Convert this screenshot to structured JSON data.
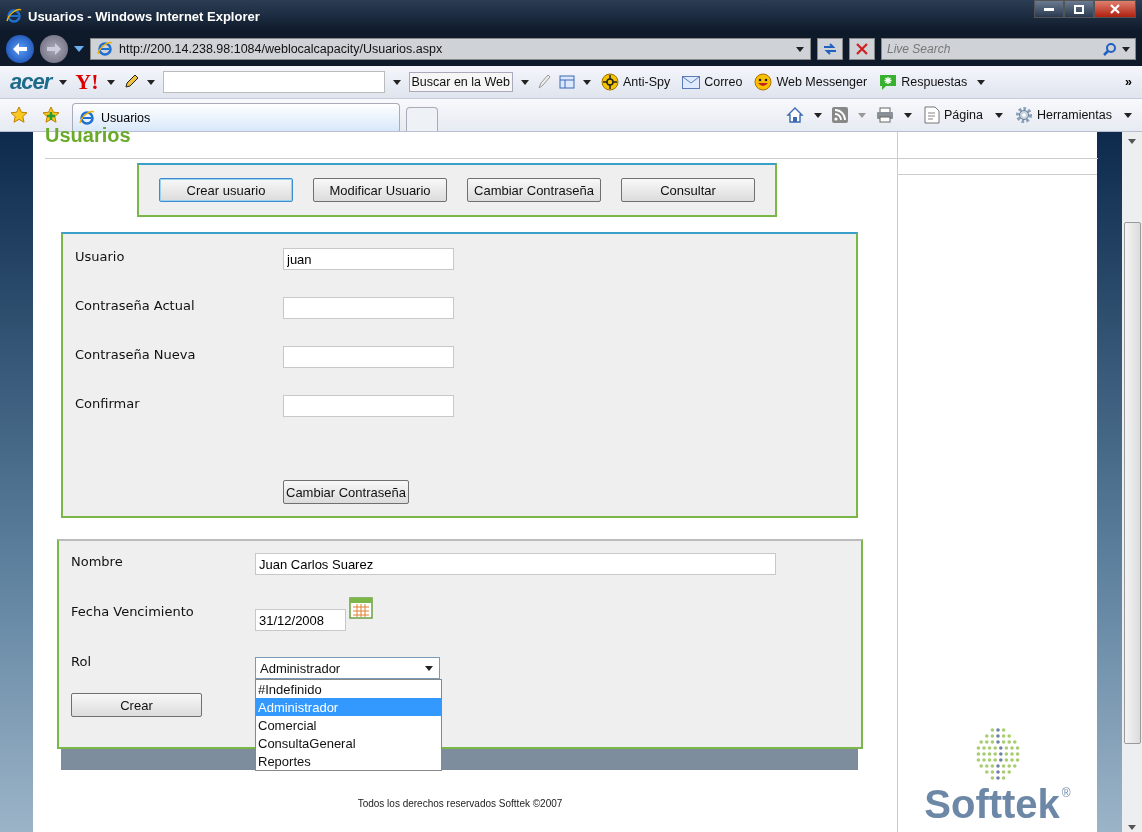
{
  "window": {
    "title": "Usuarios - Windows Internet Explorer"
  },
  "address_bar": {
    "url": "http://200.14.238.98:1084/weblocalcapacity/Usuarios.aspx"
  },
  "search": {
    "placeholder": "Live Search"
  },
  "toolbar": {
    "logos": [
      "acer",
      "Y!"
    ],
    "overflow": "»",
    "search_button": "Buscar en la Web",
    "items": [
      {
        "kind": "antispy",
        "label": "Anti-Spy"
      },
      {
        "kind": "mail",
        "label": "Correo"
      },
      {
        "kind": "messenger",
        "label": "Web Messenger"
      },
      {
        "kind": "answers",
        "label": "Respuestas"
      }
    ]
  },
  "tabs": [
    {
      "label": "Usuarios"
    }
  ],
  "command_bar": [
    {
      "kind": "page",
      "label": "Página"
    },
    {
      "kind": "tools",
      "label": "Herramientas"
    }
  ],
  "page": {
    "heading": "Usuarios",
    "actions": [
      {
        "label": "Crear usuario",
        "selected": true
      },
      {
        "label": "Modificar Usuario",
        "selected": false
      },
      {
        "label": "Cambiar Contraseña",
        "selected": false
      },
      {
        "label": "Consultar",
        "selected": false
      }
    ],
    "password_form": {
      "fields": [
        {
          "label": "Usuario",
          "value": "juan"
        },
        {
          "label": "Contraseña Actual"
        },
        {
          "label": "Contraseña Nueva"
        },
        {
          "label": "Confirmar"
        }
      ],
      "button": "Cambiar Contraseña"
    },
    "user_form": {
      "name": {
        "label": "Nombre",
        "value": "Juan Carlos Suarez"
      },
      "expiry": {
        "label": "Fecha Vencimiento",
        "value": "31/12/2008"
      },
      "role": {
        "label": "Rol",
        "value": "Administrador",
        "expanded": true,
        "options": [
          {
            "label": "#Indefinido",
            "selected": false
          },
          {
            "label": "Administrador",
            "selected": true
          },
          {
            "label": "Comercial",
            "selected": false
          },
          {
            "label": "ConsultaGeneral",
            "selected": false
          },
          {
            "label": "Reportes",
            "selected": false
          }
        ]
      },
      "button": "Crear"
    },
    "footer": "Todos los derechos reservados Softtek ©2007",
    "logo": {
      "name": "Softtek",
      "mark": "®"
    }
  }
}
